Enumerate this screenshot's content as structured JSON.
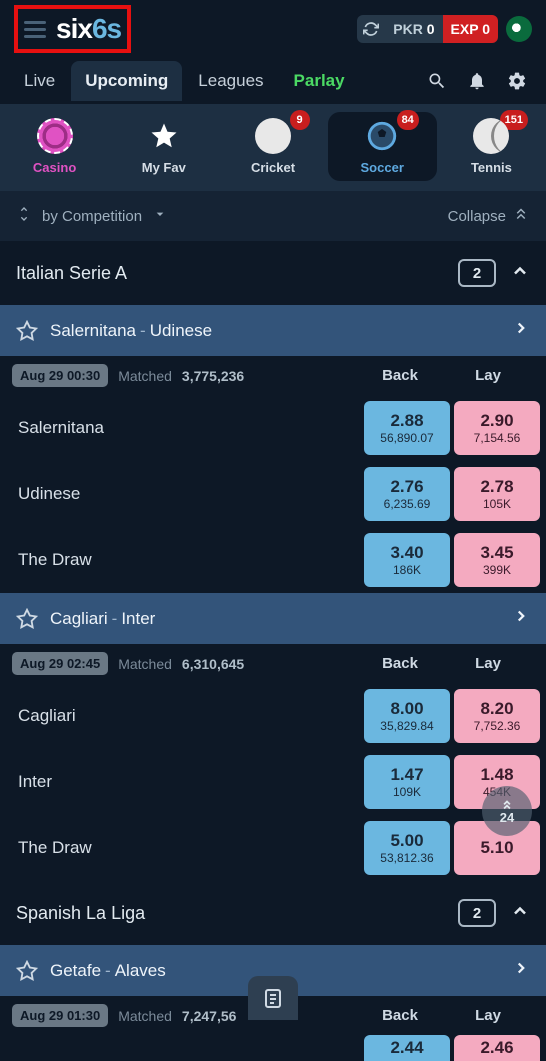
{
  "header": {
    "logo_main": "six",
    "logo_accent": "6s",
    "balance": {
      "currency_label": "PKR",
      "currency_amount": "0",
      "exposure_label": "EXP",
      "exposure_amount": "0"
    }
  },
  "tabs": {
    "live": "Live",
    "upcoming": "Upcoming",
    "leagues": "Leagues",
    "parlay": "Parlay"
  },
  "sports": {
    "casino": "Casino",
    "myfav": "My Fav",
    "cricket": "Cricket",
    "cricket_badge": "9",
    "soccer": "Soccer",
    "soccer_badge": "84",
    "tennis": "Tennis",
    "tennis_badge": "151"
  },
  "sortbar": {
    "label": "by Competition",
    "collapse": "Collapse"
  },
  "matched_label": "Matched",
  "back_label": "Back",
  "lay_label": "Lay",
  "scroll_indicator": "24",
  "leagues_list": [
    {
      "name": "Italian Serie A",
      "count": "2",
      "matches": [
        {
          "home": "Salernitana",
          "away": "Udinese",
          "time": "Aug 29 00:30",
          "matched": "3,775,236",
          "outcomes": [
            {
              "name": "Salernitana",
              "back_price": "2.88",
              "back_size": "56,890.07",
              "lay_price": "2.90",
              "lay_size": "7,154.56"
            },
            {
              "name": "Udinese",
              "back_price": "2.76",
              "back_size": "6,235.69",
              "lay_price": "2.78",
              "lay_size": "105K"
            },
            {
              "name": "The Draw",
              "back_price": "3.40",
              "back_size": "186K",
              "lay_price": "3.45",
              "lay_size": "399K"
            }
          ]
        },
        {
          "home": "Cagliari",
          "away": "Inter",
          "time": "Aug 29 02:45",
          "matched": "6,310,645",
          "outcomes": [
            {
              "name": "Cagliari",
              "back_price": "8.00",
              "back_size": "35,829.84",
              "lay_price": "8.20",
              "lay_size": "7,752.36"
            },
            {
              "name": "Inter",
              "back_price": "1.47",
              "back_size": "109K",
              "lay_price": "1.48",
              "lay_size": "454K"
            },
            {
              "name": "The Draw",
              "back_price": "5.00",
              "back_size": "53,812.36",
              "lay_price": "5.10",
              "lay_size": ""
            }
          ]
        }
      ]
    },
    {
      "name": "Spanish La Liga",
      "count": "2",
      "matches": [
        {
          "home": "Getafe",
          "away": "Alaves",
          "time": "Aug 29 01:30",
          "matched": "7,247,56",
          "outcomes": [
            {
              "name": "",
              "back_price": "2.44",
              "back_size": "",
              "lay_price": "2.46",
              "lay_size": ""
            }
          ]
        }
      ]
    }
  ]
}
